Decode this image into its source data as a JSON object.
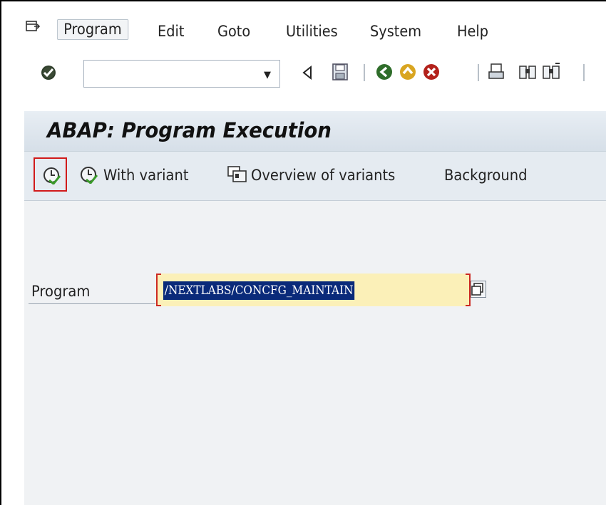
{
  "menubar": {
    "items": [
      {
        "label": "Program",
        "underline": "r"
      },
      {
        "label": "Edit"
      },
      {
        "label": "Goto"
      },
      {
        "label": "Utilities"
      },
      {
        "label": "System"
      },
      {
        "label": "Help"
      }
    ]
  },
  "toolbar": {
    "command_value": "",
    "icons": [
      "enter-icon",
      "back-icon",
      "save-icon",
      "green-back-icon",
      "exit-icon",
      "cancel-icon",
      "print-icon",
      "find-icon",
      "find-next-icon"
    ]
  },
  "screen": {
    "title": "ABAP: Program Execution",
    "app_toolbar": {
      "with_variant": "With variant",
      "overview_of_variants": "Overview of variants",
      "background": "Background"
    },
    "field": {
      "label": "Program",
      "value": "/NEXTLABS/CONCFG_MAINTAIN"
    }
  },
  "colors": {
    "title_bar": "#d6dfe8",
    "app_toolbar": "#e5ebf1",
    "screen_bg": "#f0f2f4",
    "input_required": "#fbf0b8",
    "selection": "#0a2a7a",
    "highlight_box": "#d11a1a"
  }
}
